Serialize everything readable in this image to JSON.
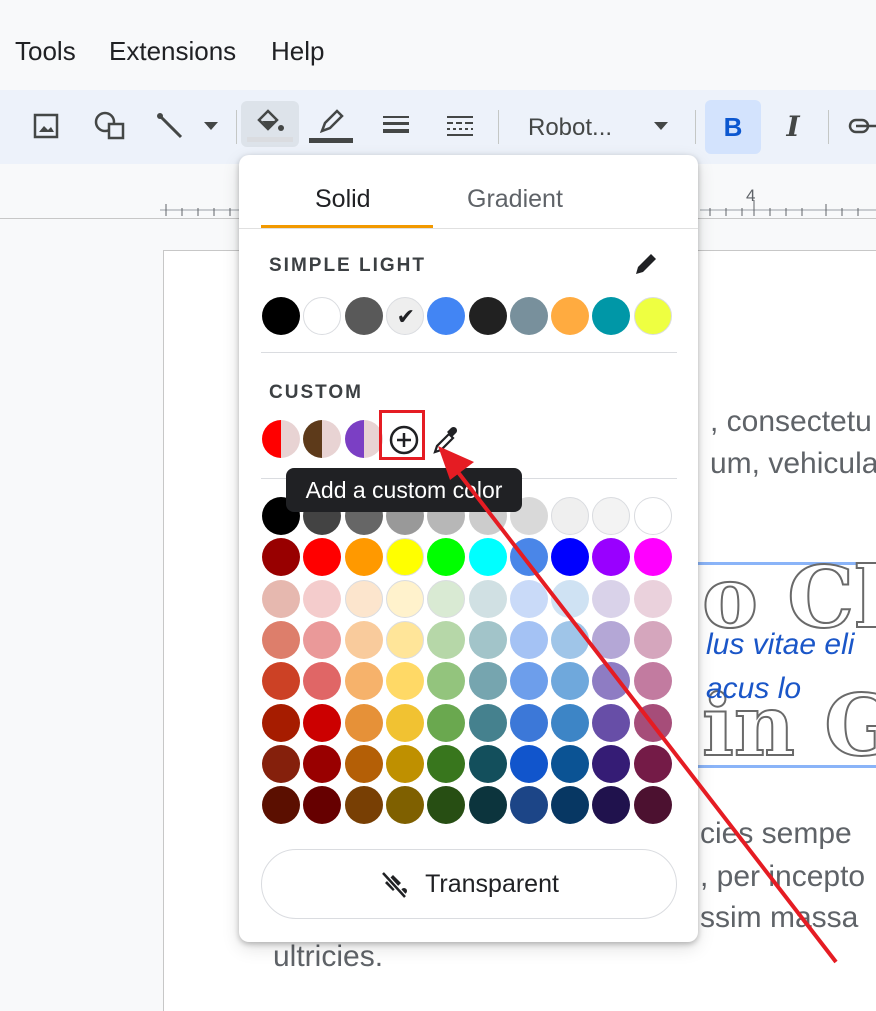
{
  "menubar": {
    "items": [
      "Tools",
      "Extensions",
      "Help"
    ]
  },
  "toolbar": {
    "font": "Robot...",
    "buttons": [
      "image-icon",
      "shapes-icon",
      "line-icon",
      "fill-color-icon",
      "border-color-icon",
      "border-weight-icon",
      "border-dash-icon",
      "bold-icon",
      "italic-icon",
      "link-icon"
    ],
    "fill_swatch_color": "#dadce0",
    "border_swatch_color": "#444746"
  },
  "ruler": {
    "mark": "4"
  },
  "document": {
    "lines": [
      ", consectetu",
      "um, vehicula",
      "cies sempe",
      ", per incepto",
      "ssim massa",
      "ultricies."
    ],
    "italic_lines": [
      "lus vitae eli",
      "acus lo"
    ],
    "big_text": [
      "o Ch",
      "in G"
    ]
  },
  "color_picker": {
    "tabs": [
      "Solid",
      "Gradient"
    ],
    "active_tab": "Solid",
    "theme_label": "SIMPLE LIGHT",
    "theme_colors": [
      "#000000",
      "#ffffff",
      "#595959",
      "#eeeeee",
      "#4285f4",
      "#212121",
      "#78909c",
      "#ffab40",
      "#0097a7",
      "#eeff41"
    ],
    "theme_selected_index": 3,
    "custom_label": "CUSTOM",
    "custom_colors": [
      "#ff0000",
      "#5d3a1a",
      "#7b3fc4"
    ],
    "add_custom_tooltip": "Add a custom color",
    "palette": [
      [
        "#000000",
        "#434343",
        "#666666",
        "#999999",
        "#b7b7b7",
        "#cccccc",
        "#d9d9d9",
        "#efefef",
        "#f3f3f3",
        "#ffffff"
      ],
      [
        "#980000",
        "#ff0000",
        "#ff9900",
        "#ffff00",
        "#00ff00",
        "#00ffff",
        "#4a86e8",
        "#0000ff",
        "#9900ff",
        "#ff00ff"
      ],
      [
        "#e6b8af",
        "#f4cccc",
        "#fce5cd",
        "#fff2cc",
        "#d9ead3",
        "#d0e0e3",
        "#c9daf8",
        "#cfe2f3",
        "#d9d2e9",
        "#ead1dc"
      ],
      [
        "#dd7e6b",
        "#ea9999",
        "#f9cb9c",
        "#ffe599",
        "#b6d7a8",
        "#a2c4c9",
        "#a4c2f4",
        "#9fc5e8",
        "#b4a7d6",
        "#d5a6bd"
      ],
      [
        "#cc4125",
        "#e06666",
        "#f6b26b",
        "#ffd966",
        "#93c47d",
        "#76a5af",
        "#6d9eeb",
        "#6fa8dc",
        "#8e7cc3",
        "#c27ba0"
      ],
      [
        "#a61c00",
        "#cc0000",
        "#e69138",
        "#f1c232",
        "#6aa84f",
        "#45818e",
        "#3c78d8",
        "#3d85c6",
        "#674ea7",
        "#a64d79"
      ],
      [
        "#85200c",
        "#990000",
        "#b45f06",
        "#bf9000",
        "#38761d",
        "#134f5c",
        "#1155cc",
        "#0b5394",
        "#351c75",
        "#741b47"
      ],
      [
        "#5b0f00",
        "#660000",
        "#783f04",
        "#7f6000",
        "#274e13",
        "#0c343d",
        "#1c4587",
        "#073763",
        "#20124d",
        "#4c1130"
      ]
    ],
    "transparent_label": "Transparent"
  },
  "annotation": {
    "color": "#e51c23"
  }
}
